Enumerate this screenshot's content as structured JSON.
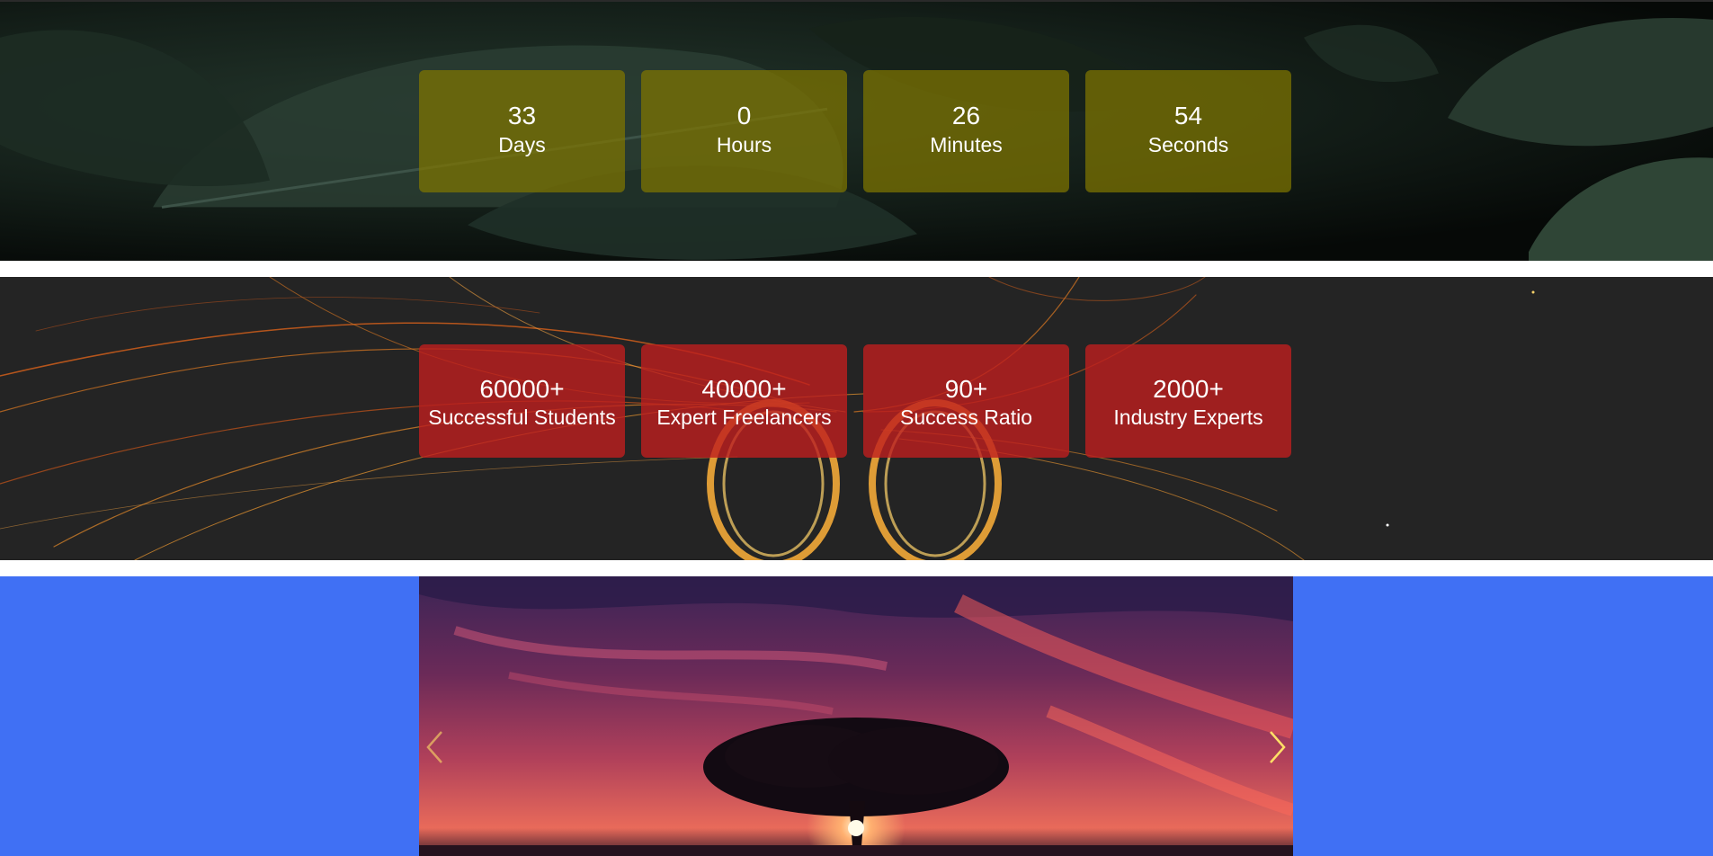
{
  "countdown": [
    {
      "value": "33",
      "label": "Days"
    },
    {
      "value": "0",
      "label": "Hours"
    },
    {
      "value": "26",
      "label": "Minutes"
    },
    {
      "value": "54",
      "label": "Seconds"
    }
  ],
  "stats": [
    {
      "value": "60000+",
      "label": "Successful Students"
    },
    {
      "value": "40000+",
      "label": "Expert Freelancers"
    },
    {
      "value": "90+",
      "label": "Success Ratio"
    },
    {
      "value": "2000+",
      "label": "Industry Experts"
    }
  ],
  "carousel": {
    "prev_icon": "chevron-left-icon",
    "next_icon": "chevron-right-icon"
  },
  "colors": {
    "countdown_box": "#807600",
    "stats_box": "#be1e1e",
    "carousel_bg": "#4070f4",
    "arrow": "#ffe066"
  }
}
